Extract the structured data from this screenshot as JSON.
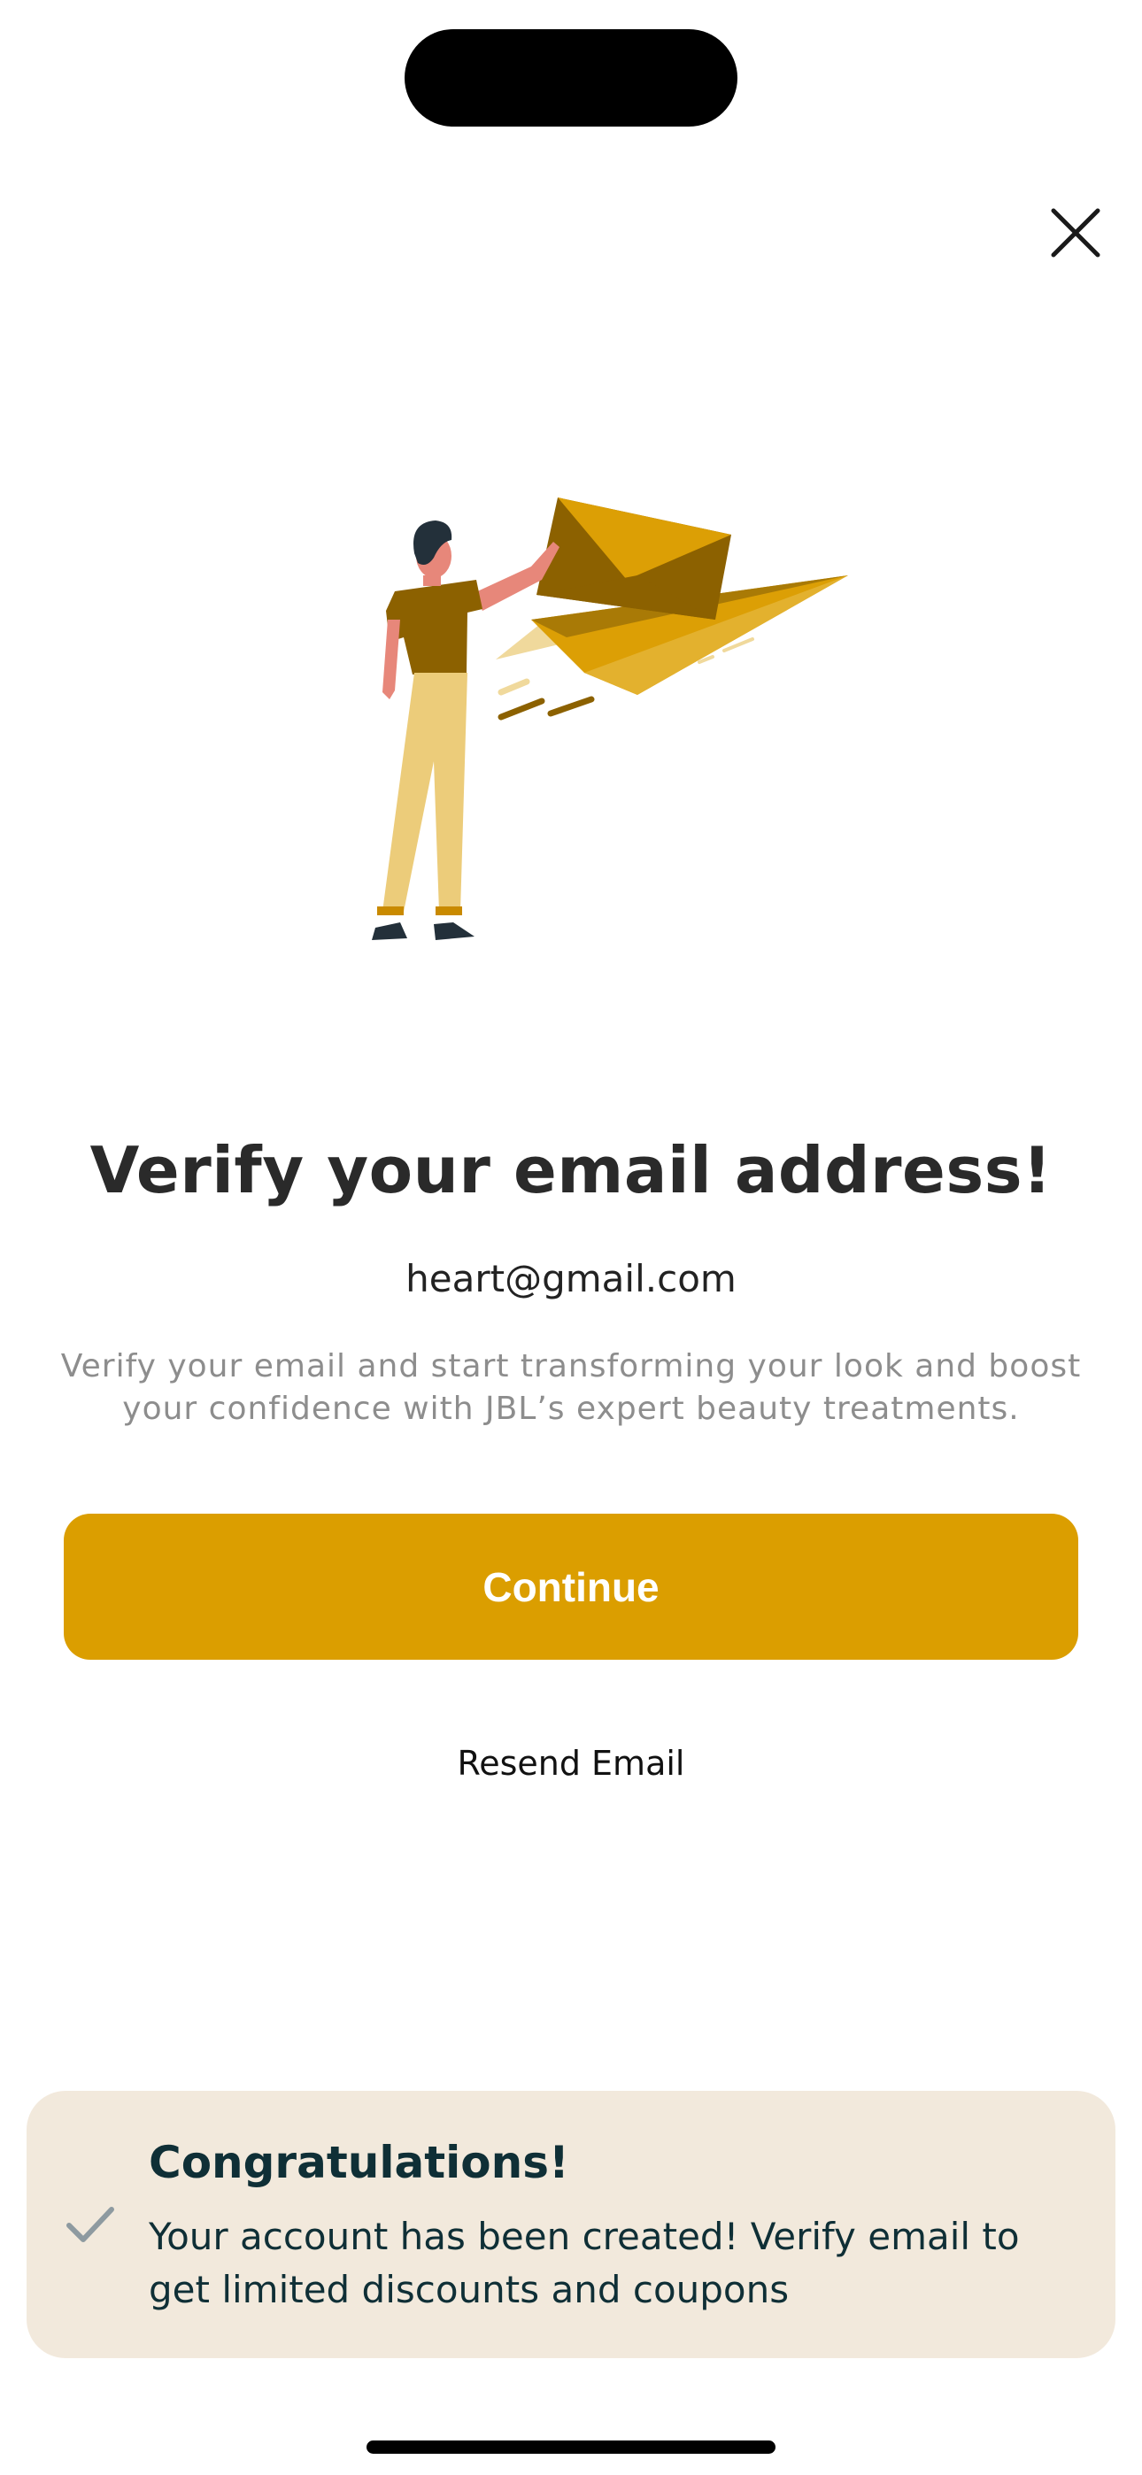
{
  "screen": {
    "title": "Verify your email address!",
    "email": "heart@gmail.com",
    "description": "Verify your email and start transforming your look and boost your confidence with JBL’s expert beauty treatments.",
    "continue_label": "Continue",
    "resend_label": "Resend Email"
  },
  "toast": {
    "title": "Congratulations!",
    "message": "Your account has been created! Verify email to get limited discounts and coupons"
  },
  "icons": {
    "close": "close-icon",
    "check": "check-icon",
    "illustration": "person-sending-envelope-illustration"
  },
  "colors": {
    "accent": "#db9e00",
    "toast_bg": "#f2e9dc",
    "toast_text": "#0f2f36",
    "title_text": "#2a2a2a",
    "muted_text": "#8d8d8d"
  }
}
